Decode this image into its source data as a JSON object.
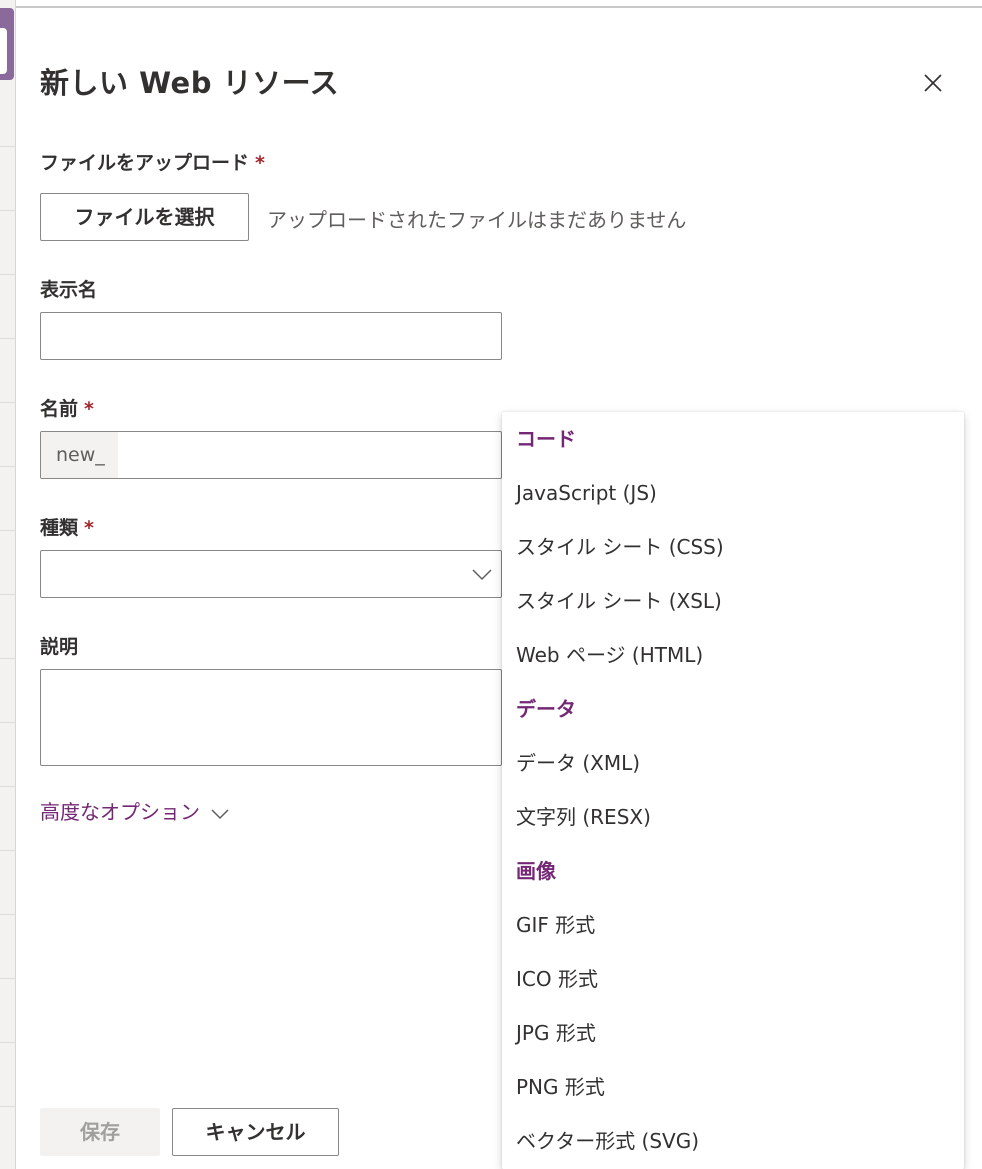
{
  "panel": {
    "title": "新しい Web リソース"
  },
  "colors": {
    "accent": "#742774",
    "required": "#a4262c",
    "border": "#8a8886",
    "disabled_bg": "#f3f2f1"
  },
  "upload": {
    "label": "ファイルをアップロード",
    "required_mark": "*",
    "button_label": "ファイルを選択",
    "status": "アップロードされたファイルはまだありません"
  },
  "display_name": {
    "label": "表示名",
    "value": ""
  },
  "name": {
    "label": "名前",
    "required_mark": "*",
    "prefix": "new_",
    "value": ""
  },
  "type": {
    "label": "種類",
    "required_mark": "*",
    "value": ""
  },
  "description": {
    "label": "説明",
    "value": ""
  },
  "advanced": {
    "label": "高度なオプション"
  },
  "footer": {
    "save_label": "保存",
    "cancel_label": "キャンセル"
  },
  "type_menu": {
    "code_header": "コード",
    "code_items": [
      "JavaScript (JS)",
      "スタイル シート (CSS)",
      "スタイル シート (XSL)",
      "Web ページ (HTML)"
    ],
    "data_header": "データ",
    "data_items": [
      "データ (XML)",
      "文字列 (RESX)"
    ],
    "image_header": "画像",
    "image_items": [
      "GIF 形式",
      "ICO 形式",
      "JPG 形式",
      "PNG 形式",
      "ベクター形式 (SVG)"
    ]
  },
  "icons": {
    "close": "close-icon",
    "dropdown": "chevron-down-icon",
    "advanced": "chevron-down-icon"
  }
}
